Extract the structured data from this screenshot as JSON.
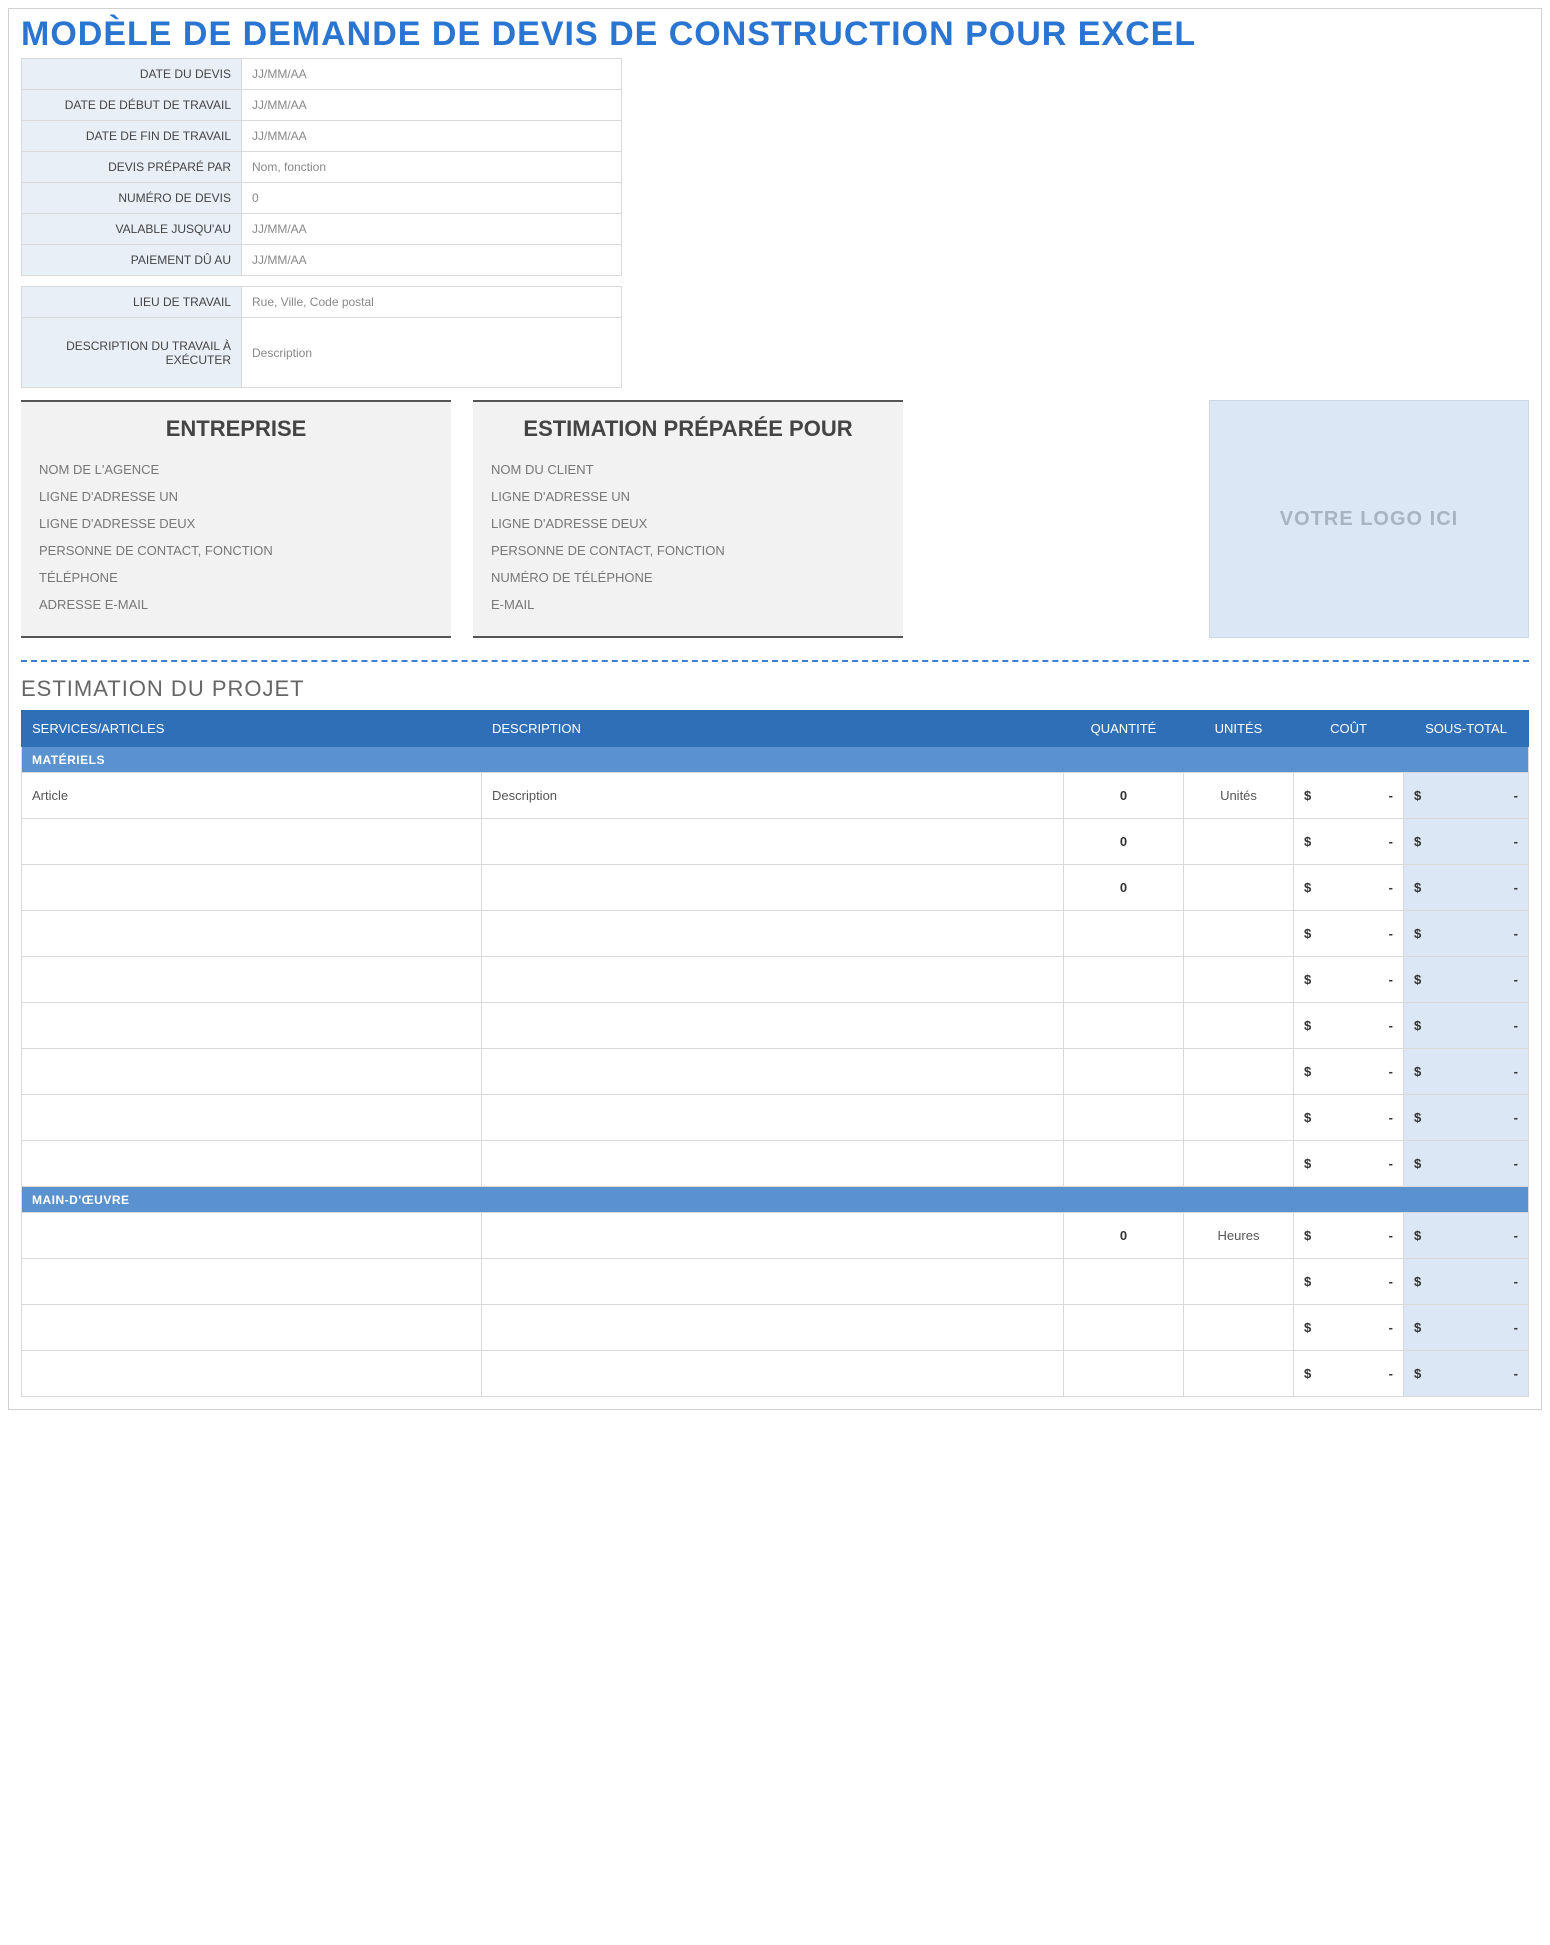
{
  "title": "MODÈLE DE DEMANDE DE DEVIS DE CONSTRUCTION POUR EXCEL",
  "meta1": [
    {
      "label": "DATE DU DEVIS",
      "value": "JJ/MM/AA"
    },
    {
      "label": "DATE DE DÉBUT DE TRAVAIL",
      "value": "JJ/MM/AA"
    },
    {
      "label": "DATE DE FIN DE TRAVAIL",
      "value": "JJ/MM/AA"
    },
    {
      "label": "DEVIS PRÉPARÉ PAR",
      "value": "Nom, fonction"
    },
    {
      "label": "NUMÉRO DE DEVIS",
      "value": "0"
    },
    {
      "label": "VALABLE JUSQU'AU",
      "value": "JJ/MM/AA"
    },
    {
      "label": "PAIEMENT DÛ AU",
      "value": "JJ/MM/AA"
    }
  ],
  "meta2": [
    {
      "label": "LIEU DE TRAVAIL",
      "value": "Rue, Ville, Code postal",
      "tall": false
    },
    {
      "label": "DESCRIPTION DU TRAVAIL À EXÉCUTER",
      "value": "Description",
      "tall": true
    }
  ],
  "company_card": {
    "heading": "ENTREPRISE",
    "lines": [
      "NOM DE L'AGENCE",
      "LIGNE D'ADRESSE UN",
      "LIGNE D'ADRESSE DEUX",
      "PERSONNE DE CONTACT, FONCTION",
      "TÉLÉPHONE",
      "ADRESSE E-MAIL"
    ]
  },
  "client_card": {
    "heading": "ESTIMATION PRÉPARÉE POUR",
    "lines": [
      "NOM DU CLIENT",
      "LIGNE D'ADRESSE UN",
      "LIGNE D'ADRESSE DEUX",
      "PERSONNE DE CONTACT, FONCTION",
      "NUMÉRO DE TÉLÉPHONE",
      "E-MAIL"
    ]
  },
  "logo_placeholder": "VOTRE LOGO ICI",
  "project_section_title": "ESTIMATION DU PROJET",
  "project_table": {
    "headers": {
      "services": "SERVICES/ARTICLES",
      "description": "DESCRIPTION",
      "qty": "QUANTITÉ",
      "units": "UNITÉS",
      "cost": "COÛT",
      "subtotal": "SOUS-TOTAL"
    },
    "currency": "$",
    "dash": "-",
    "categories": [
      {
        "name": "MATÉRIELS",
        "rows": [
          {
            "service": "Article",
            "description": "Description",
            "qty": "0",
            "units": "Unités",
            "cost": "-",
            "subtotal": "-"
          },
          {
            "service": "",
            "description": "",
            "qty": "0",
            "units": "",
            "cost": "-",
            "subtotal": "-"
          },
          {
            "service": "",
            "description": "",
            "qty": "0",
            "units": "",
            "cost": "-",
            "subtotal": "-"
          },
          {
            "service": "",
            "description": "",
            "qty": "",
            "units": "",
            "cost": "-",
            "subtotal": "-"
          },
          {
            "service": "",
            "description": "",
            "qty": "",
            "units": "",
            "cost": "-",
            "subtotal": "-"
          },
          {
            "service": "",
            "description": "",
            "qty": "",
            "units": "",
            "cost": "-",
            "subtotal": "-"
          },
          {
            "service": "",
            "description": "",
            "qty": "",
            "units": "",
            "cost": "-",
            "subtotal": "-"
          },
          {
            "service": "",
            "description": "",
            "qty": "",
            "units": "",
            "cost": "-",
            "subtotal": "-"
          },
          {
            "service": "",
            "description": "",
            "qty": "",
            "units": "",
            "cost": "-",
            "subtotal": "-"
          }
        ]
      },
      {
        "name": "MAIN-D'ŒUVRE",
        "rows": [
          {
            "service": "",
            "description": "",
            "qty": "0",
            "units": "Heures",
            "cost": "-",
            "subtotal": "-"
          },
          {
            "service": "",
            "description": "",
            "qty": "",
            "units": "",
            "cost": "-",
            "subtotal": "-"
          },
          {
            "service": "",
            "description": "",
            "qty": "",
            "units": "",
            "cost": "-",
            "subtotal": "-"
          },
          {
            "service": "",
            "description": "",
            "qty": "",
            "units": "",
            "cost": "-",
            "subtotal": "-"
          }
        ]
      }
    ]
  }
}
